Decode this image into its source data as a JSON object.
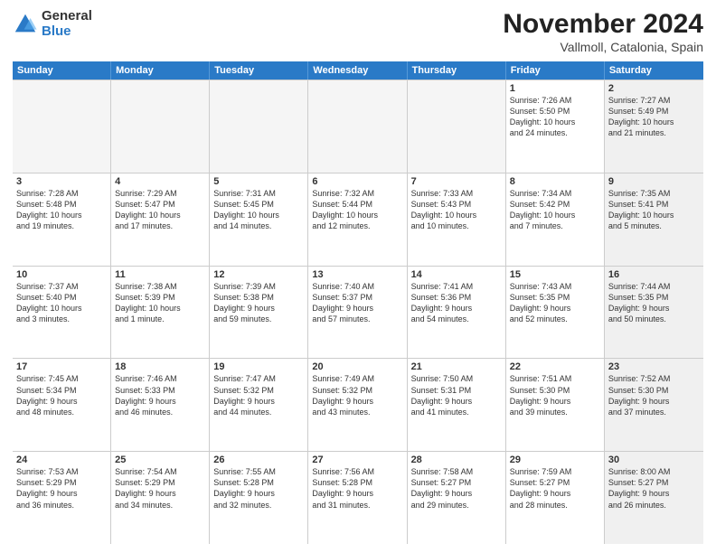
{
  "logo": {
    "general": "General",
    "blue": "Blue"
  },
  "title": {
    "month": "November 2024",
    "location": "Vallmoll, Catalonia, Spain"
  },
  "header": {
    "days": [
      "Sunday",
      "Monday",
      "Tuesday",
      "Wednesday",
      "Thursday",
      "Friday",
      "Saturday"
    ]
  },
  "weeks": [
    [
      {
        "day": "",
        "empty": true
      },
      {
        "day": "",
        "empty": true
      },
      {
        "day": "",
        "empty": true
      },
      {
        "day": "",
        "empty": true
      },
      {
        "day": "",
        "empty": true
      },
      {
        "day": "1",
        "info": "Sunrise: 7:26 AM\nSunset: 5:50 PM\nDaylight: 10 hours\nand 24 minutes."
      },
      {
        "day": "2",
        "info": "Sunrise: 7:27 AM\nSunset: 5:49 PM\nDaylight: 10 hours\nand 21 minutes.",
        "shaded": true
      }
    ],
    [
      {
        "day": "3",
        "info": "Sunrise: 7:28 AM\nSunset: 5:48 PM\nDaylight: 10 hours\nand 19 minutes."
      },
      {
        "day": "4",
        "info": "Sunrise: 7:29 AM\nSunset: 5:47 PM\nDaylight: 10 hours\nand 17 minutes."
      },
      {
        "day": "5",
        "info": "Sunrise: 7:31 AM\nSunset: 5:45 PM\nDaylight: 10 hours\nand 14 minutes."
      },
      {
        "day": "6",
        "info": "Sunrise: 7:32 AM\nSunset: 5:44 PM\nDaylight: 10 hours\nand 12 minutes."
      },
      {
        "day": "7",
        "info": "Sunrise: 7:33 AM\nSunset: 5:43 PM\nDaylight: 10 hours\nand 10 minutes."
      },
      {
        "day": "8",
        "info": "Sunrise: 7:34 AM\nSunset: 5:42 PM\nDaylight: 10 hours\nand 7 minutes."
      },
      {
        "day": "9",
        "info": "Sunrise: 7:35 AM\nSunset: 5:41 PM\nDaylight: 10 hours\nand 5 minutes.",
        "shaded": true
      }
    ],
    [
      {
        "day": "10",
        "info": "Sunrise: 7:37 AM\nSunset: 5:40 PM\nDaylight: 10 hours\nand 3 minutes."
      },
      {
        "day": "11",
        "info": "Sunrise: 7:38 AM\nSunset: 5:39 PM\nDaylight: 10 hours\nand 1 minute."
      },
      {
        "day": "12",
        "info": "Sunrise: 7:39 AM\nSunset: 5:38 PM\nDaylight: 9 hours\nand 59 minutes."
      },
      {
        "day": "13",
        "info": "Sunrise: 7:40 AM\nSunset: 5:37 PM\nDaylight: 9 hours\nand 57 minutes."
      },
      {
        "day": "14",
        "info": "Sunrise: 7:41 AM\nSunset: 5:36 PM\nDaylight: 9 hours\nand 54 minutes."
      },
      {
        "day": "15",
        "info": "Sunrise: 7:43 AM\nSunset: 5:35 PM\nDaylight: 9 hours\nand 52 minutes."
      },
      {
        "day": "16",
        "info": "Sunrise: 7:44 AM\nSunset: 5:35 PM\nDaylight: 9 hours\nand 50 minutes.",
        "shaded": true
      }
    ],
    [
      {
        "day": "17",
        "info": "Sunrise: 7:45 AM\nSunset: 5:34 PM\nDaylight: 9 hours\nand 48 minutes."
      },
      {
        "day": "18",
        "info": "Sunrise: 7:46 AM\nSunset: 5:33 PM\nDaylight: 9 hours\nand 46 minutes."
      },
      {
        "day": "19",
        "info": "Sunrise: 7:47 AM\nSunset: 5:32 PM\nDaylight: 9 hours\nand 44 minutes."
      },
      {
        "day": "20",
        "info": "Sunrise: 7:49 AM\nSunset: 5:32 PM\nDaylight: 9 hours\nand 43 minutes."
      },
      {
        "day": "21",
        "info": "Sunrise: 7:50 AM\nSunset: 5:31 PM\nDaylight: 9 hours\nand 41 minutes."
      },
      {
        "day": "22",
        "info": "Sunrise: 7:51 AM\nSunset: 5:30 PM\nDaylight: 9 hours\nand 39 minutes."
      },
      {
        "day": "23",
        "info": "Sunrise: 7:52 AM\nSunset: 5:30 PM\nDaylight: 9 hours\nand 37 minutes.",
        "shaded": true
      }
    ],
    [
      {
        "day": "24",
        "info": "Sunrise: 7:53 AM\nSunset: 5:29 PM\nDaylight: 9 hours\nand 36 minutes."
      },
      {
        "day": "25",
        "info": "Sunrise: 7:54 AM\nSunset: 5:29 PM\nDaylight: 9 hours\nand 34 minutes."
      },
      {
        "day": "26",
        "info": "Sunrise: 7:55 AM\nSunset: 5:28 PM\nDaylight: 9 hours\nand 32 minutes."
      },
      {
        "day": "27",
        "info": "Sunrise: 7:56 AM\nSunset: 5:28 PM\nDaylight: 9 hours\nand 31 minutes."
      },
      {
        "day": "28",
        "info": "Sunrise: 7:58 AM\nSunset: 5:27 PM\nDaylight: 9 hours\nand 29 minutes."
      },
      {
        "day": "29",
        "info": "Sunrise: 7:59 AM\nSunset: 5:27 PM\nDaylight: 9 hours\nand 28 minutes."
      },
      {
        "day": "30",
        "info": "Sunrise: 8:00 AM\nSunset: 5:27 PM\nDaylight: 9 hours\nand 26 minutes.",
        "shaded": true
      }
    ]
  ]
}
